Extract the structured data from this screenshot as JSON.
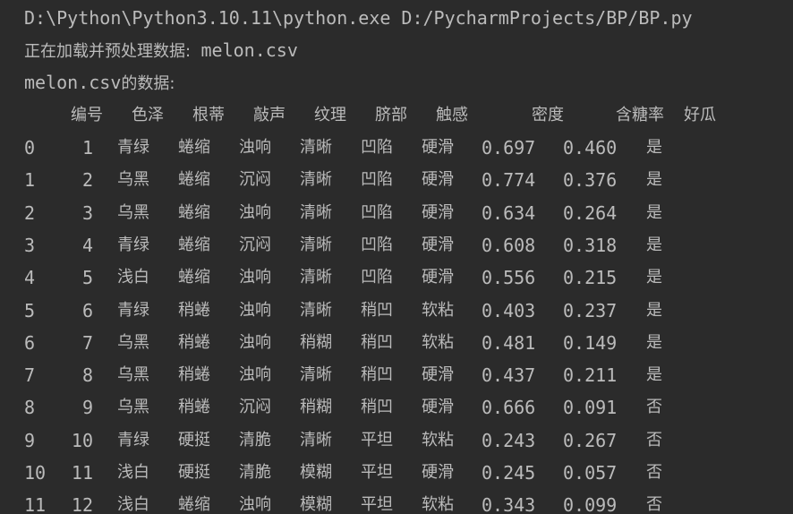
{
  "console": {
    "command": "D:\\Python\\Python3.10.11\\python.exe D:/PycharmProjects/BP/BP.py",
    "loading_prefix": "正在加载并预处理数据:  ",
    "loading_file": "melon.csv",
    "data_file": "melon.csv",
    "data_suffix": "的数据:"
  },
  "table": {
    "columns": [
      "编号",
      "色泽",
      "根蒂",
      "敲声",
      "纹理",
      "脐部",
      "触感",
      "密度",
      "含糖率",
      "好瓜"
    ],
    "rows": [
      [
        "0",
        "1",
        "青绿",
        "蜷缩",
        "浊响",
        "清晰",
        "凹陷",
        "硬滑",
        "0.697",
        "0.460",
        "是"
      ],
      [
        "1",
        "2",
        "乌黑",
        "蜷缩",
        "沉闷",
        "清晰",
        "凹陷",
        "硬滑",
        "0.774",
        "0.376",
        "是"
      ],
      [
        "2",
        "3",
        "乌黑",
        "蜷缩",
        "浊响",
        "清晰",
        "凹陷",
        "硬滑",
        "0.634",
        "0.264",
        "是"
      ],
      [
        "3",
        "4",
        "青绿",
        "蜷缩",
        "沉闷",
        "清晰",
        "凹陷",
        "硬滑",
        "0.608",
        "0.318",
        "是"
      ],
      [
        "4",
        "5",
        "浅白",
        "蜷缩",
        "浊响",
        "清晰",
        "凹陷",
        "硬滑",
        "0.556",
        "0.215",
        "是"
      ],
      [
        "5",
        "6",
        "青绿",
        "稍蜷",
        "浊响",
        "清晰",
        "稍凹",
        "软粘",
        "0.403",
        "0.237",
        "是"
      ],
      [
        "6",
        "7",
        "乌黑",
        "稍蜷",
        "浊响",
        "稍糊",
        "稍凹",
        "软粘",
        "0.481",
        "0.149",
        "是"
      ],
      [
        "7",
        "8",
        "乌黑",
        "稍蜷",
        "浊响",
        "清晰",
        "稍凹",
        "硬滑",
        "0.437",
        "0.211",
        "是"
      ],
      [
        "8",
        "9",
        "乌黑",
        "稍蜷",
        "沉闷",
        "稍糊",
        "稍凹",
        "硬滑",
        "0.666",
        "0.091",
        "否"
      ],
      [
        "9",
        "10",
        "青绿",
        "硬挺",
        "清脆",
        "清晰",
        "平坦",
        "软粘",
        "0.243",
        "0.267",
        "否"
      ],
      [
        "10",
        "11",
        "浅白",
        "硬挺",
        "清脆",
        "模糊",
        "平坦",
        "硬滑",
        "0.245",
        "0.057",
        "否"
      ],
      [
        "11",
        "12",
        "浅白",
        "蜷缩",
        "浊响",
        "模糊",
        "平坦",
        "软粘",
        "0.343",
        "0.099",
        "否"
      ]
    ]
  },
  "colors": {
    "background": "#2b2b2b",
    "text": "#bbbbbb"
  }
}
